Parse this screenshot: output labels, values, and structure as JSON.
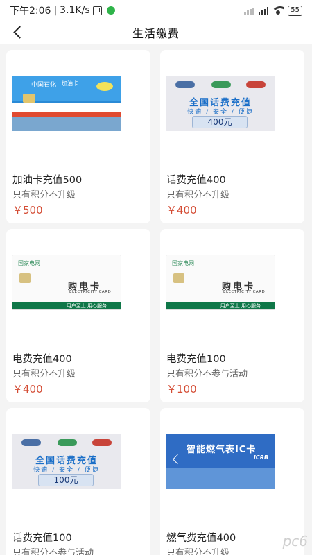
{
  "status": {
    "time": "下午2:06",
    "speed": "3.1K/s",
    "battery": "55"
  },
  "header": {
    "title": "生活缴费"
  },
  "cards": [
    {
      "title": "加油卡充值500",
      "subtitle": "只有积分不升级",
      "price": "￥500",
      "image": "fuel-card",
      "art": {
        "brand": "中国石化",
        "label": "加油卡"
      }
    },
    {
      "title": "话费充值400",
      "subtitle": "只有积分不升级",
      "price": "￥400",
      "image": "phone-card",
      "art": {
        "headline": "全国话费充值",
        "tagline": "快速 / 安全 / 便捷",
        "amount": "400元"
      }
    },
    {
      "title": "电费充值400",
      "subtitle": "只有积分不升级",
      "price": "￥400",
      "image": "electricity-card",
      "art": {
        "brand": "国家电网",
        "headline": "购电卡",
        "english": "ELECTRICITY CARD",
        "slogan": "用户至上 用心服务"
      }
    },
    {
      "title": "电费充值100",
      "subtitle": "只有积分不参与活动",
      "price": "￥100",
      "image": "electricity-card",
      "art": {
        "brand": "国家电网",
        "headline": "购电卡",
        "english": "ELECTRICITY CARD",
        "slogan": "用户至上 用心服务"
      }
    },
    {
      "title": "话费充值100",
      "subtitle": "只有积分不参与活动",
      "price": "",
      "image": "phone-card",
      "art": {
        "headline": "全国话费充值",
        "tagline": "快速 / 安全 / 便捷",
        "amount": "100元"
      }
    },
    {
      "title": "燃气费充值400",
      "subtitle": "只有积分不升级",
      "price": "",
      "image": "gas-card",
      "art": {
        "headline": "智能燃气表IC卡",
        "brand": "ICRB"
      }
    }
  ],
  "watermark": "pc6"
}
